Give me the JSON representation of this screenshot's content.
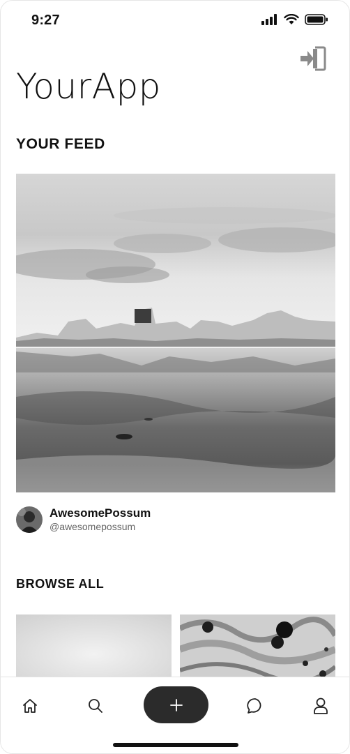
{
  "status_bar": {
    "time": "9:27"
  },
  "header": {
    "app_title": "YourApp"
  },
  "feed": {
    "title": "YOUR FEED",
    "post": {
      "author_name": "AwesomePossum",
      "author_handle": "@awesomepossum"
    }
  },
  "browse": {
    "title": "BROWSE ALL"
  },
  "icons": {
    "logout": "logout-icon",
    "home": "home-icon",
    "search": "search-icon",
    "add": "plus-icon",
    "chat": "chat-icon",
    "profile": "user-icon"
  },
  "colors": {
    "fab_background": "#2b2b2b",
    "logout_icon": "#8a8a8a"
  }
}
